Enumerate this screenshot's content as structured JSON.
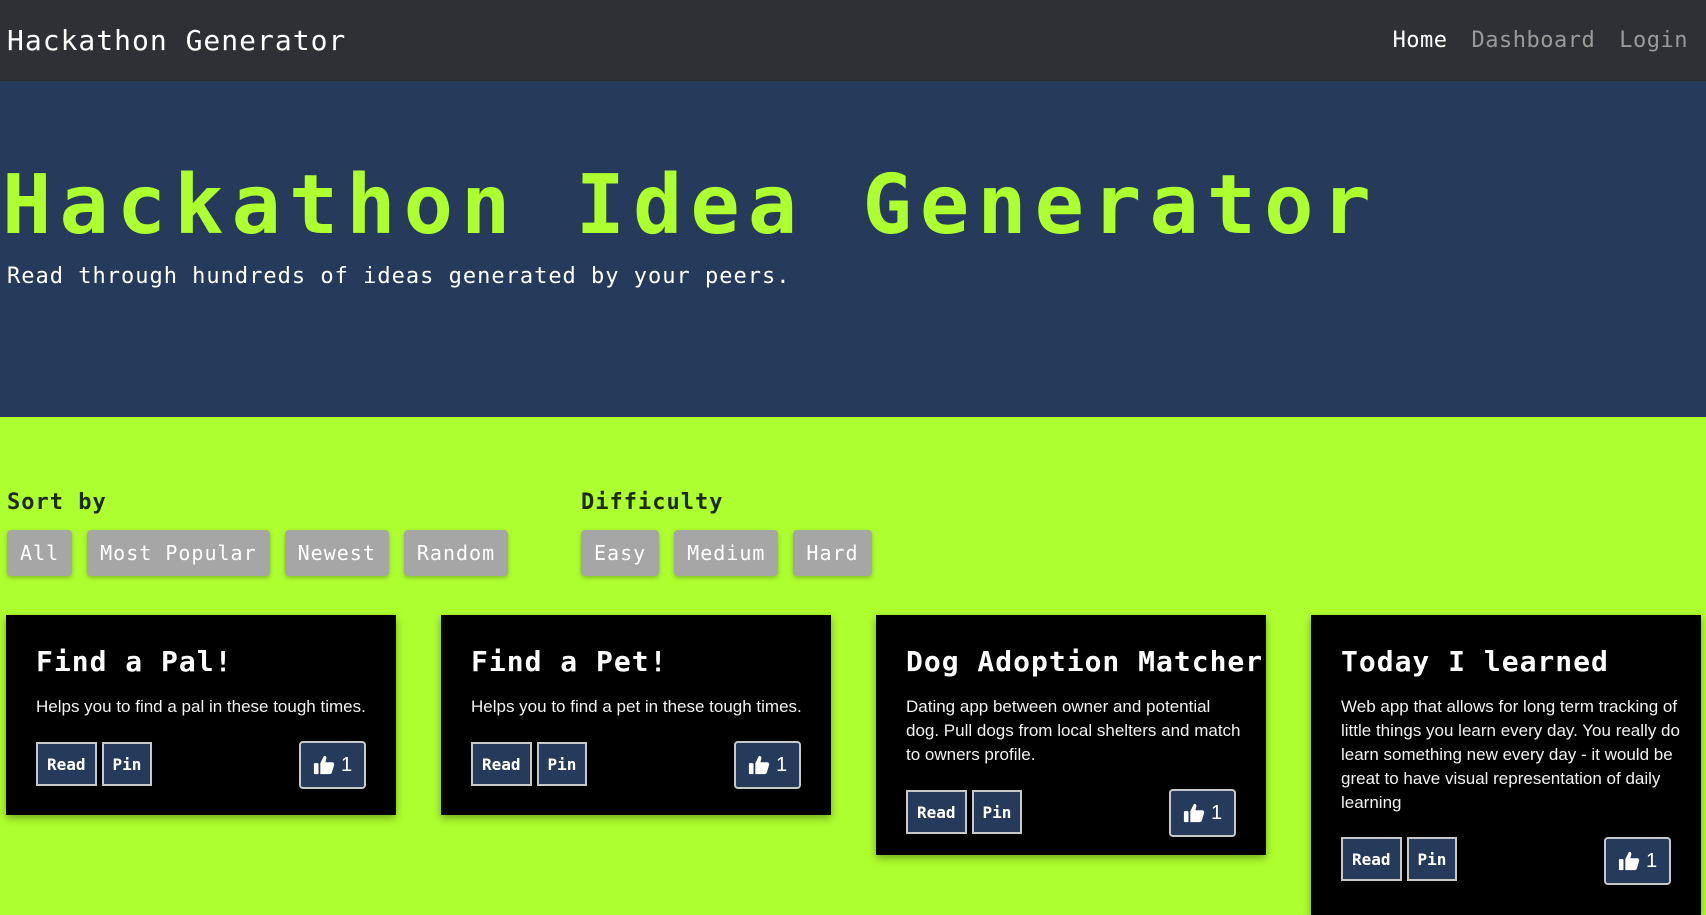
{
  "navbar": {
    "brand": "Hackathon Generator",
    "links": [
      {
        "label": "Home"
      },
      {
        "label": "Dashboard"
      },
      {
        "label": "Login"
      }
    ]
  },
  "hero": {
    "title": "Hackathon Idea Generator",
    "subtitle": "Read through hundreds of ideas generated by your peers."
  },
  "filters": {
    "sort": {
      "label": "Sort by",
      "options": [
        "All",
        "Most Popular",
        "Newest",
        "Random"
      ]
    },
    "difficulty": {
      "label": "Difficulty",
      "options": [
        "Easy",
        "Medium",
        "Hard"
      ]
    }
  },
  "ideas": [
    {
      "title": "Find a Pal!",
      "description": "Helps you to find a pal in these tough times.",
      "read_label": "Read",
      "pin_label": "Pin",
      "likes": "1"
    },
    {
      "title": "Find a Pet!",
      "description": "Helps you to find a pet in these tough times.",
      "read_label": "Read",
      "pin_label": "Pin",
      "likes": "1"
    },
    {
      "title": "Dog Adoption Matcher",
      "description": "Dating app between owner and potential dog. Pull dogs from local shelters and match to owners profile.",
      "read_label": "Read",
      "pin_label": "Pin",
      "likes": "1"
    },
    {
      "title": "Today I learned",
      "description": "Web app that allows for long term tracking of little things you learn every day. You really do learn something new every day - it would be great to have visual representation of daily learning",
      "read_label": "Read",
      "pin_label": "Pin",
      "likes": "1"
    }
  ],
  "colors": {
    "navbar_bg": "#2f3035",
    "hero_bg": "#263a5c",
    "accent": "#aeff2f",
    "card_bg": "#000000",
    "filter_btn_bg": "#a6a6a6"
  },
  "icons": {
    "like": "thumbs-up-icon"
  }
}
